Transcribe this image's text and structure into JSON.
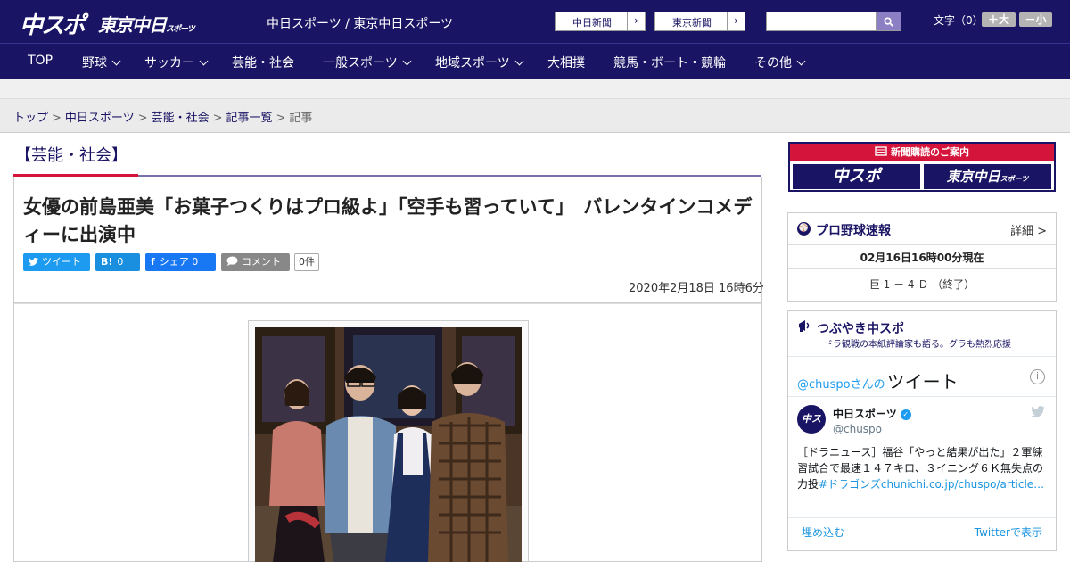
{
  "header": {
    "logo_main": "中スポ",
    "logo_tokyo": "東京中日",
    "logo_tokyo_small": "スポーツ",
    "site_subtitle": "中日スポーツ / 東京中日スポーツ",
    "links": [
      {
        "label": "中日新聞",
        "arrow": "›"
      },
      {
        "label": "東京新聞",
        "arrow": "›"
      }
    ],
    "search_placeholder": "",
    "search_icon": "search-icon",
    "font_size_label": "文字（0）",
    "font_up": "＋大",
    "font_down": "－小"
  },
  "nav": [
    {
      "label": "TOP",
      "dropdown": false
    },
    {
      "label": "野球",
      "dropdown": true
    },
    {
      "label": "サッカー",
      "dropdown": true
    },
    {
      "label": "芸能・社会",
      "dropdown": false
    },
    {
      "label": "一般スポーツ",
      "dropdown": true
    },
    {
      "label": "地域スポーツ",
      "dropdown": true
    },
    {
      "label": "大相撲",
      "dropdown": false
    },
    {
      "label": "競馬・ボート・競輪",
      "dropdown": false
    },
    {
      "label": "その他",
      "dropdown": true
    }
  ],
  "breadcrumb": {
    "items": [
      "トップ",
      "中日スポーツ",
      "芸能・社会",
      "記事一覧"
    ],
    "current": "記事",
    "separator": ">"
  },
  "article": {
    "category": "【芸能・社会】",
    "title": "女優の前島亜美「お菓子つくりはプロ級よ」「空手も習っていて」　バレンタインコメディーに出演中",
    "share": {
      "tweet": "ツイート",
      "hatena_icon": "B!",
      "hatena_count": "0",
      "facebook_icon": "f",
      "facebook_label": "シェア 0",
      "comment": "コメント",
      "comment_count": "0件"
    },
    "date": "2020年2月18日 16時6分"
  },
  "sidebar": {
    "subscription": {
      "heading": "新聞購読のご案内",
      "logo1": "中スポ",
      "logo2": "東京中日",
      "logo2_small": "スポーツ"
    },
    "baseball": {
      "title": "プロ野球速報",
      "more": "詳細 >",
      "time": "02月16日16時00分現在",
      "score": "巨 1 － 4 Ｄ （終了）"
    },
    "tweets": {
      "title": "つぶやき中スポ",
      "subtitle": "ドラ観戦の本紙評論家も語る。グラも熱烈応援",
      "handle_prefix": "@chuspoさんの",
      "header_word": "ツイート",
      "info": "i",
      "account_name": "中日スポーツ",
      "verified": "✓",
      "account_handle": "@chuspo",
      "avatar_text": "中スポ",
      "body": "［ドラニュース］福谷「やっと結果が出た」２軍練習試合で最速１４７キロ、３イニング６Ｋ無失点の力投",
      "hashtag": "#ドラゴンズ",
      "link": "chunichi.co.jp/chuspo/article…",
      "embed": "埋め込む",
      "view": "Twitterで表示"
    }
  }
}
